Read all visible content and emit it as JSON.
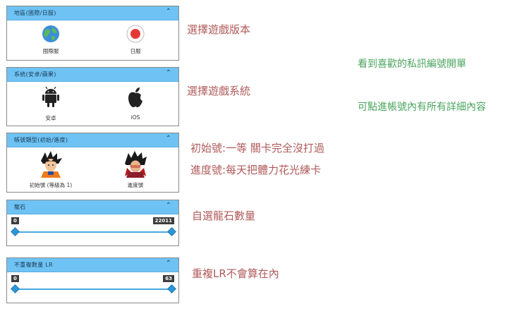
{
  "panels": {
    "region": {
      "title": "地區(國際/日服)",
      "left_label": "國際服",
      "right_label": "日服",
      "left_icon": "globe-icon",
      "right_icon": "red-record-icon"
    },
    "system": {
      "title": "系統(安卓/蘋果)",
      "left_label": "安卓",
      "right_label": "iOS",
      "left_icon": "android-icon",
      "right_icon": "apple-icon"
    },
    "account_type": {
      "title": "帳號類型(初始/進度)",
      "left_label": "初始號 (等級為 1)",
      "right_label": "進度號",
      "left_icon": "goku-character-icon",
      "right_icon": "ssj4-goku-character-icon"
    },
    "dragon_stone": {
      "title": "龍石",
      "min_label": "0",
      "max_label": "22011",
      "min_value": 0,
      "max_value": 22011
    },
    "non_dup_lr": {
      "title": "不重複數量 LR",
      "min_label": "0",
      "max_label": "63",
      "min_value": 0,
      "max_value": 63
    }
  },
  "notes": {
    "version": "選擇遊戲版本",
    "system": "選擇遊戲系統",
    "initial": "初始號:一等 關卡完全沒打過",
    "progress": "進度號:每天把體力花光練卡",
    "stones": "自選龍石數量",
    "lr": "重複LR不會算在內",
    "message": "看到喜歡的私訊編號開單",
    "details": "可點進帳號內有所有詳細內容"
  },
  "colors": {
    "header": "#6ec3f4",
    "slider": "#2f96d6",
    "note_red": "#b05a5a",
    "note_green": "#4aa55e"
  }
}
